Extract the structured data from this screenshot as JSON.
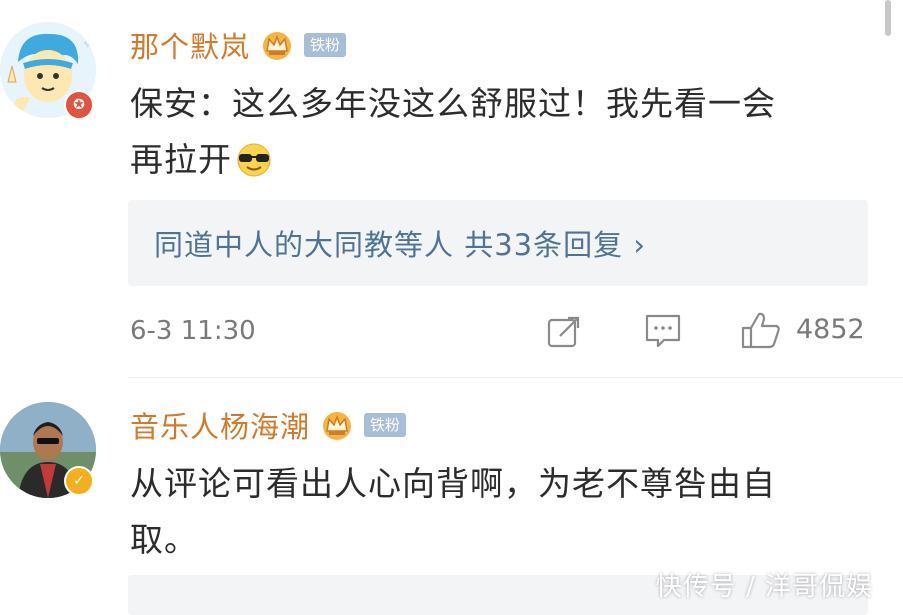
{
  "comments": [
    {
      "username": "那个默岚",
      "fan_tag": "铁粉",
      "text_line1": "保安：这么多年没这么舒服过！我先看一会",
      "text_line2": "再拉开",
      "emoji": "sunglasses-emoji",
      "reply_summary": "同道中人的大同教等人  共33条回复 ›",
      "time": "6-3 11:30",
      "likes": "4852",
      "avatar_badge_color": "#e0533f"
    },
    {
      "username": "音乐人杨海潮",
      "fan_tag": "铁粉",
      "text_line1": "从评论可看出人心向背啊，为老不尊咎由自",
      "text_line2": "取。",
      "avatar_badge_color": "#f2b01e"
    }
  ],
  "watermark": "快传号 / 洋哥侃娱",
  "colors": {
    "username": "#d07b2c",
    "reply_link": "#4e7396",
    "fan_tag_bg": "#a7bed6"
  }
}
